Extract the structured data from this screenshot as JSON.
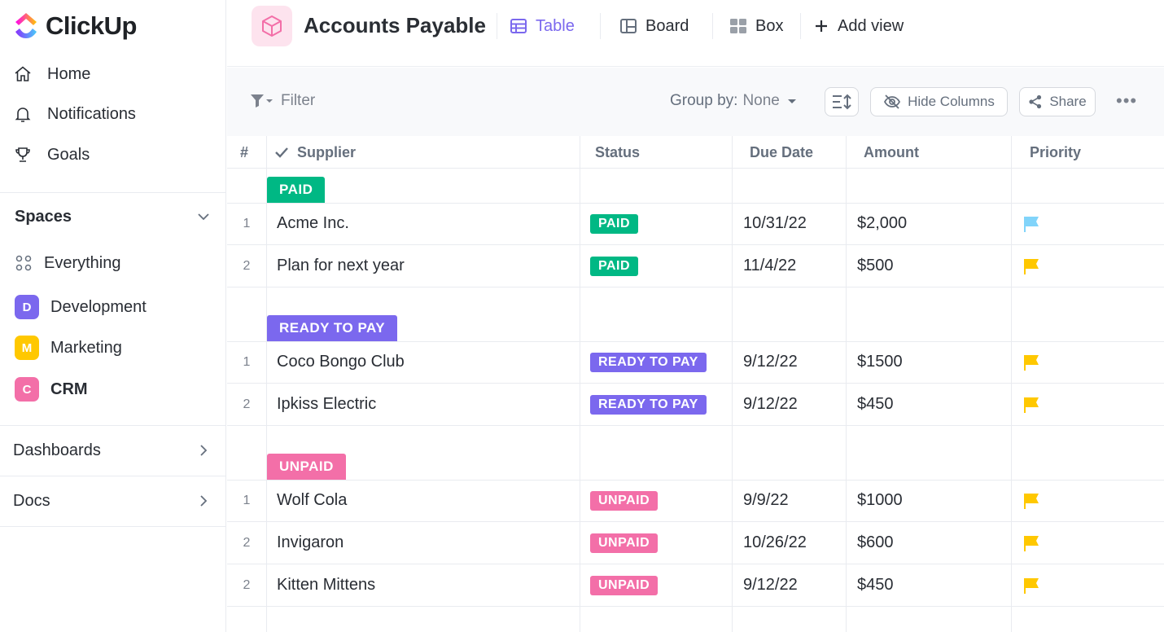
{
  "brand": {
    "name": "ClickUp"
  },
  "sidebar": {
    "nav": [
      {
        "label": "Home",
        "icon": "home-icon"
      },
      {
        "label": "Notifications",
        "icon": "bell-icon"
      },
      {
        "label": "Goals",
        "icon": "trophy-icon"
      }
    ],
    "spaces_title": "Spaces",
    "spaces": [
      {
        "label": "Everything",
        "icon": "grid-dots-icon"
      },
      {
        "label": "Development",
        "badge": "D",
        "color": "#7b68ee"
      },
      {
        "label": "Marketing",
        "badge": "M",
        "color": "#ffc800"
      },
      {
        "label": "CRM",
        "badge": "C",
        "color": "#f36fa8"
      }
    ],
    "sections": [
      {
        "label": "Dashboards"
      },
      {
        "label": "Docs"
      }
    ]
  },
  "header": {
    "title": "Accounts Payable",
    "views": [
      {
        "label": "Table",
        "icon": "table-icon",
        "active": true
      },
      {
        "label": "Board",
        "icon": "board-icon",
        "active": false
      },
      {
        "label": "Box",
        "icon": "box-icon",
        "active": false
      },
      {
        "label": "Add view",
        "icon": "plus-icon",
        "active": false
      }
    ]
  },
  "toolbar": {
    "filter_label": "Filter",
    "group_by_label": "Group by:",
    "group_by_value": "None",
    "hide_columns_label": "Hide Columns",
    "share_label": "Share",
    "more_label": "•••"
  },
  "table": {
    "columns": [
      "#",
      "Supplier",
      "Status",
      "Due Date",
      "Amount",
      "Priority"
    ],
    "groups": [
      {
        "label": "PAID",
        "color": "#00b884",
        "rows": [
          {
            "num": "1",
            "supplier": "Acme Inc.",
            "status": "PAID",
            "due": "10/31/22",
            "amount": "$2,000",
            "priority_color": "#81d4fa"
          },
          {
            "num": "2",
            "supplier": "Plan for next year",
            "status": "PAID",
            "due": "11/4/22",
            "amount": "$500",
            "priority_color": "#ffc800"
          }
        ]
      },
      {
        "label": "READY TO PAY",
        "color": "#7b68ee",
        "rows": [
          {
            "num": "1",
            "supplier": "Coco Bongo Club",
            "status": "READY TO PAY",
            "due": "9/12/22",
            "amount": "$1500",
            "priority_color": "#ffc800"
          },
          {
            "num": "2",
            "supplier": "Ipkiss Electric",
            "status": "READY TO PAY",
            "due": "9/12/22",
            "amount": "$450",
            "priority_color": "#ffc800"
          }
        ]
      },
      {
        "label": "UNPAID",
        "color": "#f36fa8",
        "rows": [
          {
            "num": "1",
            "supplier": "Wolf Cola",
            "status": "UNPAID",
            "due": "9/9/22",
            "amount": "$1000",
            "priority_color": "#ffc800"
          },
          {
            "num": "2",
            "supplier": "Invigaron",
            "status": "UNPAID",
            "due": "10/26/22",
            "amount": "$600",
            "priority_color": "#ffc800"
          },
          {
            "num": "2",
            "supplier": "Kitten Mittens",
            "status": "UNPAID",
            "due": "9/12/22",
            "amount": "$450",
            "priority_color": "#ffc800"
          }
        ]
      }
    ]
  }
}
